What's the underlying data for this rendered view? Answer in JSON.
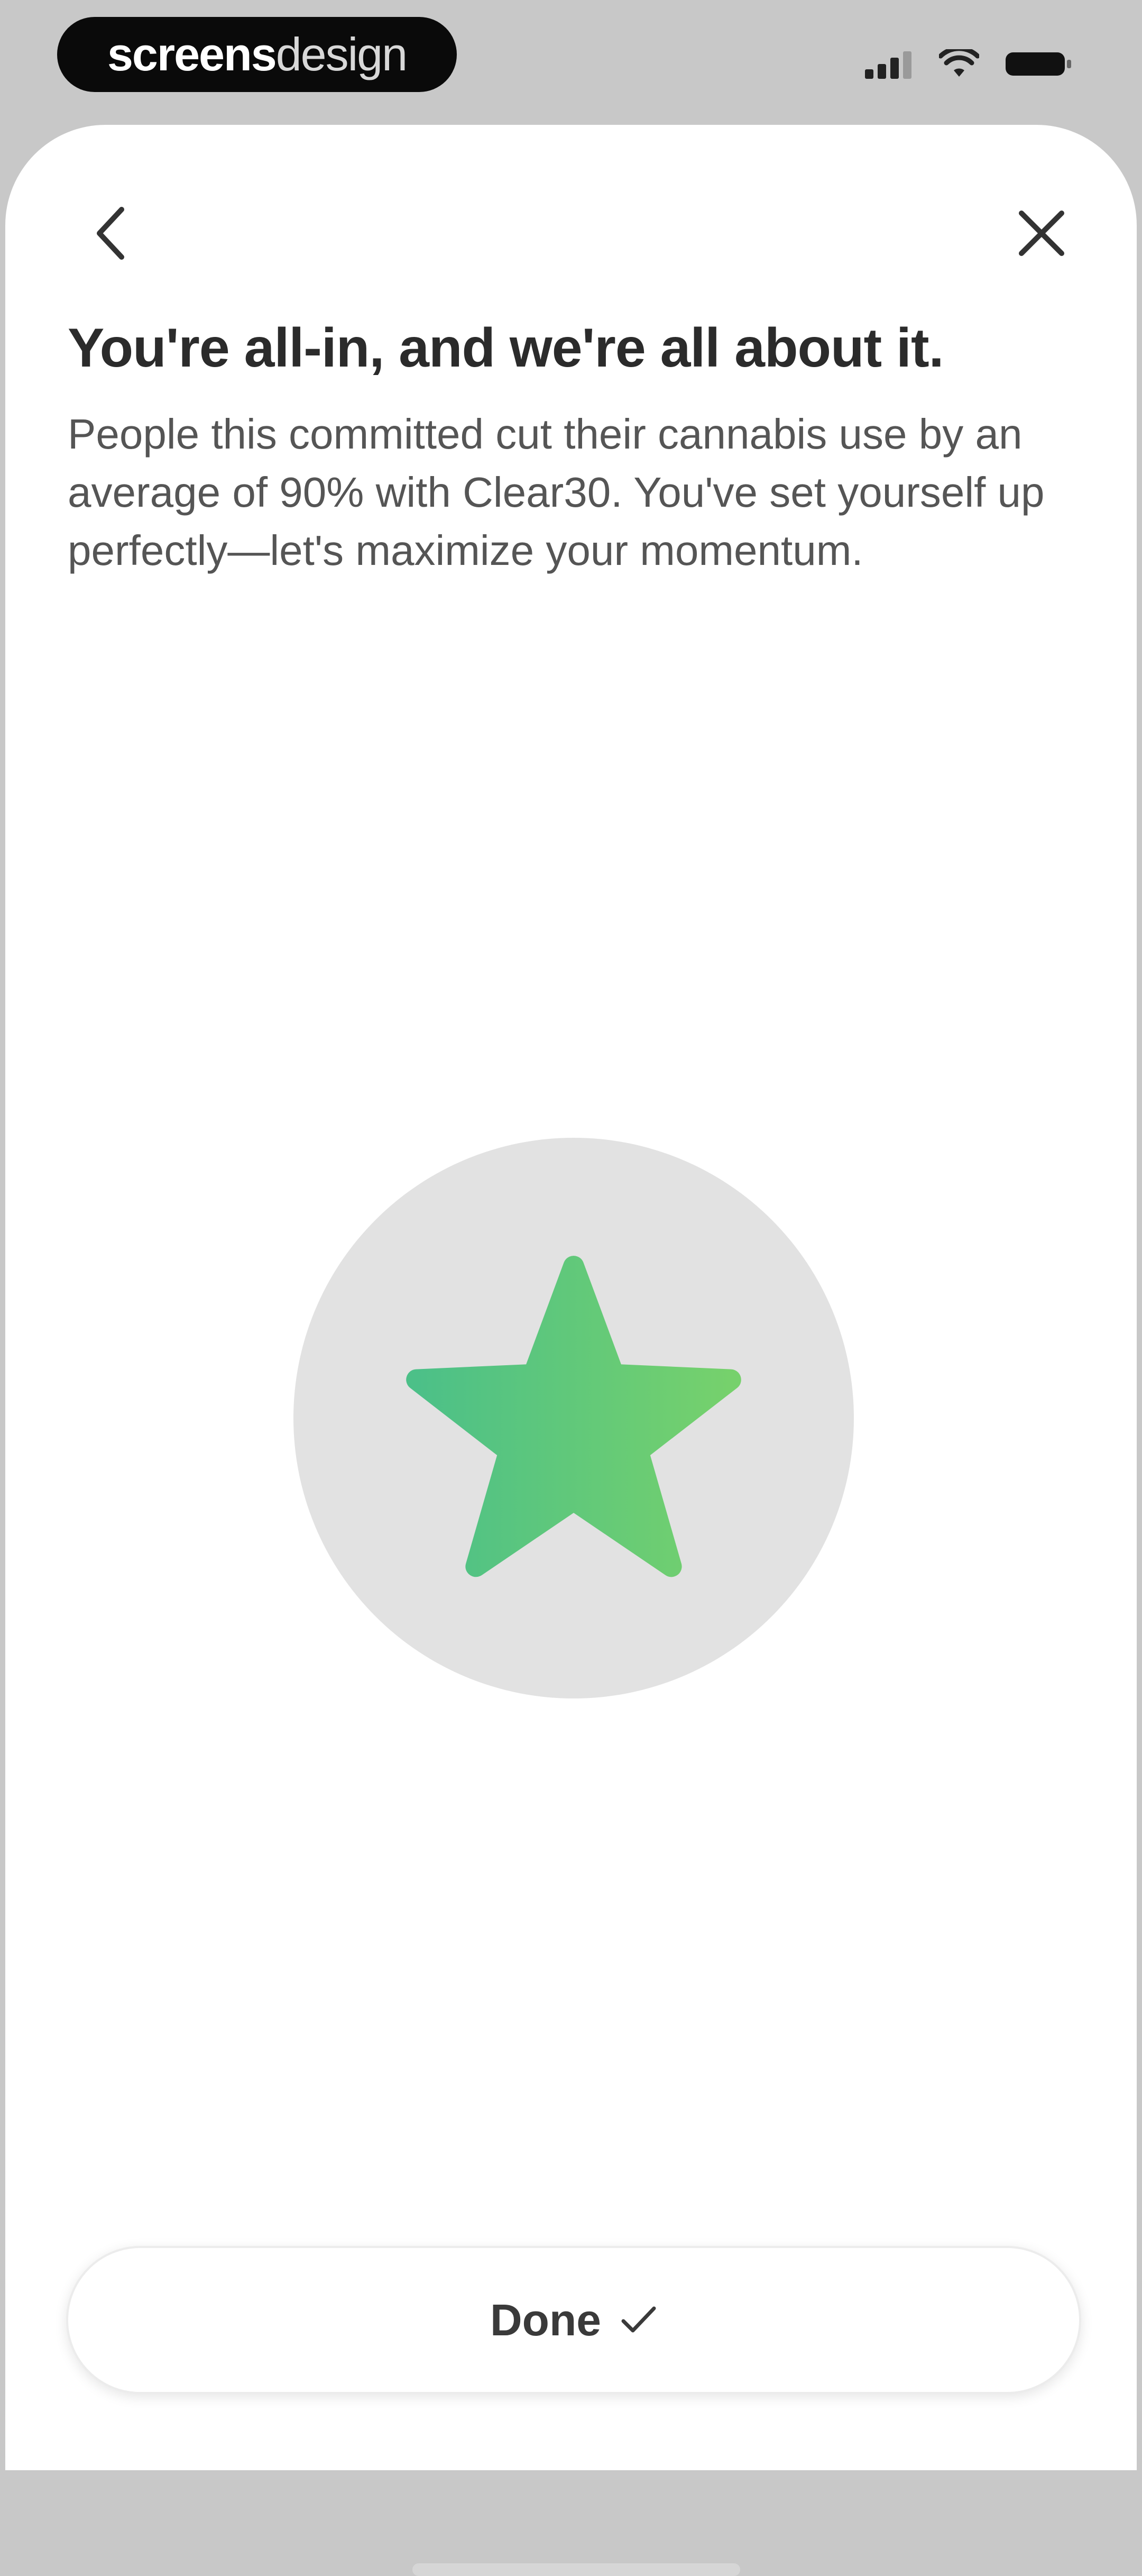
{
  "status_bar": {
    "brand_bold": "screens",
    "brand_light": "design",
    "signal_icon": "signal-icon",
    "wifi_icon": "wifi-icon",
    "battery_icon": "battery-icon"
  },
  "nav": {
    "back_icon": "chevron-left-icon",
    "close_icon": "close-icon"
  },
  "content": {
    "title": "You're all-in, and we're all about it.",
    "body": "People this committed cut their cannabis use by an average of 90% with Clear30. You've set yourself up perfectly—let's maximize your momentum.",
    "badge_icon": "star-icon"
  },
  "footer": {
    "done_label": "Done",
    "done_icon": "checkmark-icon"
  },
  "colors": {
    "accent_start": "#4cc088",
    "accent_end": "#76d16c",
    "badge_bg": "#e2e2e2",
    "text_primary": "#2b2b2b",
    "text_secondary": "#555555"
  }
}
